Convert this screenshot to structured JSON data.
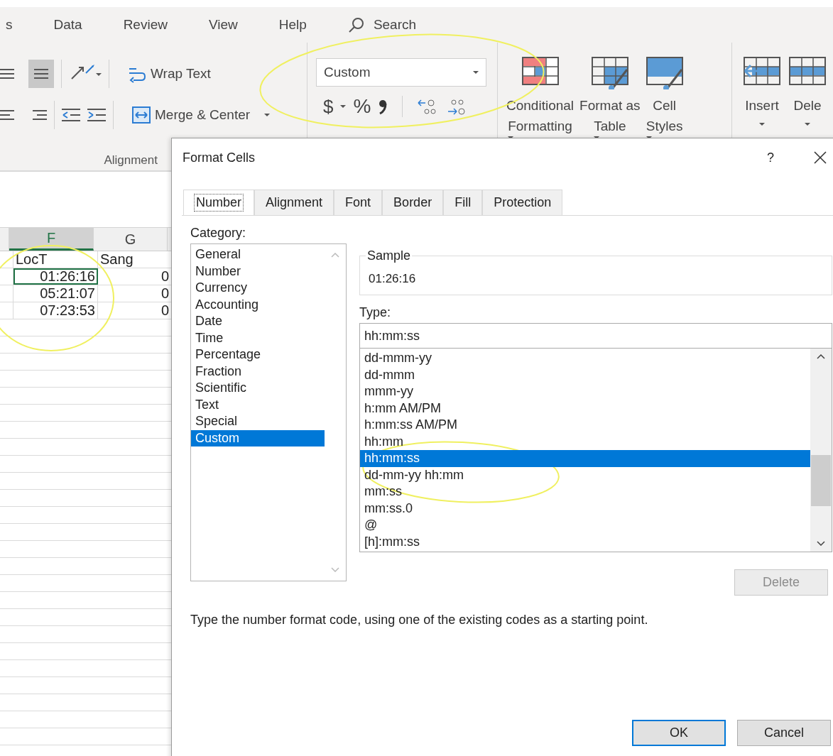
{
  "ribbon_tabs": [
    {
      "label": "s"
    },
    {
      "label": "Data"
    },
    {
      "label": "Review"
    },
    {
      "label": "View"
    },
    {
      "label": "Help"
    }
  ],
  "search": {
    "placeholder": "Search"
  },
  "alignment_group": {
    "wrap_text": "Wrap Text",
    "merge_center": "Merge & Center",
    "label": "Alignment",
    "middle_align_on": true
  },
  "number_group": {
    "format": "Custom",
    "currency": "$",
    "percent": "%"
  },
  "styles_group": [
    {
      "kind": "conditional",
      "line1": "Conditional",
      "line2": "Formatting"
    },
    {
      "kind": "table",
      "line1": "Format as",
      "line2": "Table"
    },
    {
      "kind": "cellstyles",
      "line1": "Cell",
      "line2": "Styles"
    }
  ],
  "cells_group": [
    {
      "kind": "insert",
      "label": "Insert"
    },
    {
      "kind": "delete",
      "label": "Dele"
    }
  ],
  "sheet": {
    "columns": [
      {
        "label": "F",
        "selected": true
      },
      {
        "label": "G",
        "selected": false
      }
    ],
    "rows": [
      {
        "cells": [
          {
            "text": "LocT",
            "kind": "text",
            "selected": false
          },
          {
            "text": "Sang",
            "kind": "text",
            "selected": false
          }
        ]
      },
      {
        "cells": [
          {
            "text": "01:26:16",
            "kind": "number",
            "selected": true
          },
          {
            "text": "0",
            "kind": "number",
            "selected": false
          }
        ]
      },
      {
        "cells": [
          {
            "text": "05:21:07",
            "kind": "number",
            "selected": false
          },
          {
            "text": "0",
            "kind": "number",
            "selected": false
          }
        ]
      },
      {
        "cells": [
          {
            "text": "07:23:53",
            "kind": "number",
            "selected": false
          },
          {
            "text": "0",
            "kind": "number",
            "selected": false
          }
        ]
      }
    ]
  },
  "dialog": {
    "title": "Format Cells",
    "help": "?",
    "tabs": [
      {
        "label": "Number",
        "selected": true
      },
      {
        "label": "Alignment",
        "selected": false
      },
      {
        "label": "Font",
        "selected": false
      },
      {
        "label": "Border",
        "selected": false
      },
      {
        "label": "Fill",
        "selected": false
      },
      {
        "label": "Protection",
        "selected": false
      }
    ],
    "category_label": "Category:",
    "categories": [
      {
        "label": "General",
        "selected": false
      },
      {
        "label": "Number",
        "selected": false
      },
      {
        "label": "Currency",
        "selected": false
      },
      {
        "label": "Accounting",
        "selected": false
      },
      {
        "label": "Date",
        "selected": false
      },
      {
        "label": "Time",
        "selected": false
      },
      {
        "label": "Percentage",
        "selected": false
      },
      {
        "label": "Fraction",
        "selected": false
      },
      {
        "label": "Scientific",
        "selected": false
      },
      {
        "label": "Text",
        "selected": false
      },
      {
        "label": "Special",
        "selected": false
      },
      {
        "label": "Custom",
        "selected": true
      }
    ],
    "sample_label": "Sample",
    "sample_value": "01:26:16",
    "type_label": "Type:",
    "type_value": "hh:mm:ss",
    "types": [
      {
        "label": "dd-mmm-yy",
        "selected": false
      },
      {
        "label": "dd-mmm",
        "selected": false
      },
      {
        "label": "mmm-yy",
        "selected": false
      },
      {
        "label": "h:mm AM/PM",
        "selected": false
      },
      {
        "label": "h:mm:ss AM/PM",
        "selected": false
      },
      {
        "label": "hh:mm",
        "selected": false
      },
      {
        "label": "hh:mm:ss",
        "selected": true
      },
      {
        "label": "dd-mm-yy hh:mm",
        "selected": false
      },
      {
        "label": "mm:ss",
        "selected": false
      },
      {
        "label": "mm:ss.0",
        "selected": false
      },
      {
        "label": "@",
        "selected": false
      },
      {
        "label": "[h]:mm:ss",
        "selected": false
      }
    ],
    "delete": {
      "label": "Delete",
      "disabled": true
    },
    "description": "Type the number format code, using one of the existing codes as a starting point.",
    "buttons": [
      {
        "label": "OK",
        "default": true
      },
      {
        "label": "Cancel",
        "default": false
      }
    ]
  }
}
